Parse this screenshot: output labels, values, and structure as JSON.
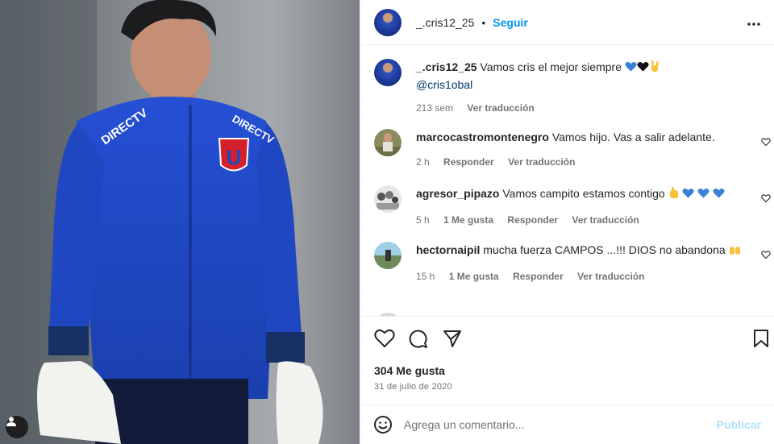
{
  "post": {
    "username": "_.cris12_25",
    "separator": "•",
    "follow_label": "Seguir",
    "more_label": "•••"
  },
  "caption": {
    "username": "_.cris12_25",
    "text": "Vamos cris el mejor siempre",
    "emojis": [
      "blue-heart",
      "black-heart",
      "rock-on-hand"
    ],
    "mention": "@cris1obal",
    "time": "213 sem",
    "translate": "Ver traducción"
  },
  "comments": [
    {
      "username": "marcocastromontenegro",
      "text": "Vamos hijo. Vas a salir adelante.",
      "time": "2 h",
      "likes": "",
      "reply": "Responder",
      "translate": "Ver traducción"
    },
    {
      "username": "agresor_pipazo",
      "text": "Vamos campito estamos contigo",
      "emojis": [
        "fist",
        "blue-heart",
        "blue-heart",
        "blue-heart"
      ],
      "time": "5 h",
      "likes": "1 Me gusta",
      "reply": "Responder",
      "translate": "Ver traducción"
    },
    {
      "username": "hectornaipil",
      "text": "mucha fuerza CAMPOS ...!!! DIOS no abandona",
      "emojis": [
        "raised-hands"
      ],
      "time": "15 h",
      "likes": "1 Me gusta",
      "reply": "Responder",
      "translate": "Ver traducción"
    }
  ],
  "footer": {
    "likes": "304 Me gusta",
    "date": "31 de julio de 2020",
    "comment_placeholder": "Agrega un comentario...",
    "post_label": "Publicar"
  },
  "photo": {
    "jersey_sponsor": "DIRECTV",
    "crest_letter": "U"
  },
  "colors": {
    "link_blue": "#0095f6",
    "muted": "#737373",
    "jersey_blue": "#1f49c7",
    "post_disabled": "#b2dffc"
  }
}
